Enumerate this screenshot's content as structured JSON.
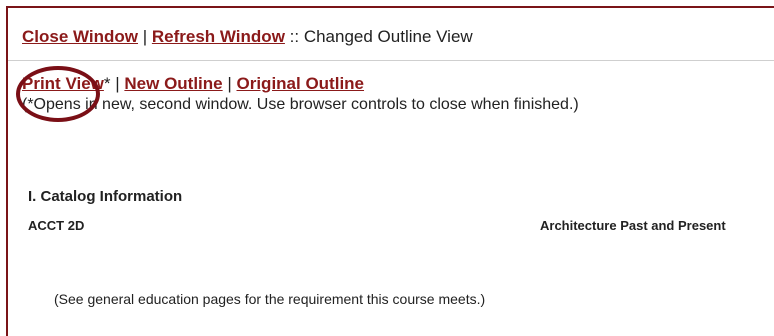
{
  "toolbar": {
    "close_window": "Close Window",
    "separator": " | ",
    "refresh_window": "Refresh Window",
    "view_label": " :: Changed Outline View"
  },
  "views": {
    "print_view": "Print View",
    "print_view_suffix": "*",
    "separator": " | ",
    "new_outline": "New Outline",
    "original_outline": "Original Outline",
    "note": "(*Opens in new, second window. Use browser controls to close when finished.)"
  },
  "catalog": {
    "section_title": "I. Catalog Information",
    "course_code": "ACCT 2D",
    "course_title": "Architecture Past and Present",
    "ge_note": "(See general education pages for the requirement this course meets.)"
  },
  "colors": {
    "link": "#8b1a1a",
    "annotation_circle": "#7a0f16",
    "frame": "#7a1418"
  }
}
